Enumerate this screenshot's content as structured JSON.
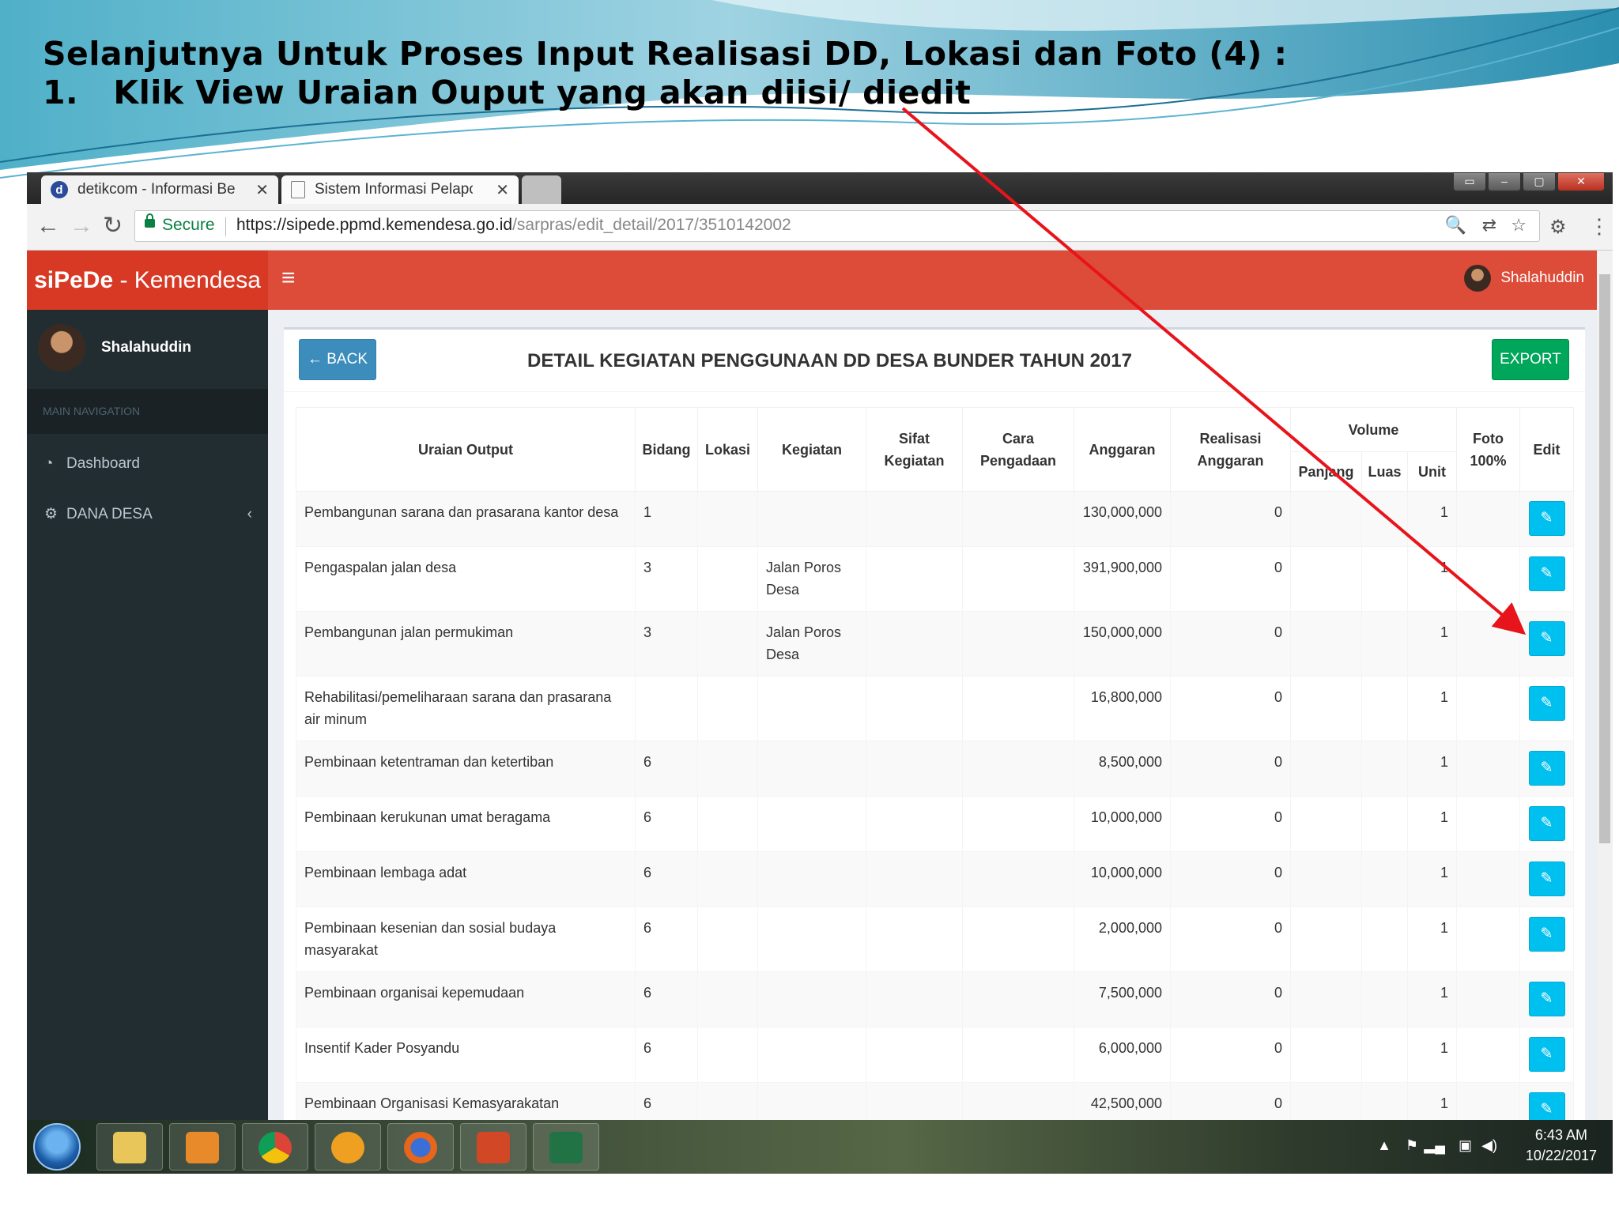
{
  "slide": {
    "title_line1": "Selanjutnya Untuk Proses Input Realisasi DD, Lokasi dan Foto (4) :",
    "title_line2": "1.   Klik View Uraian Ouput yang akan diisi/ diedit"
  },
  "browser": {
    "tabs": [
      {
        "title": "detikcom - Informasi Ber",
        "favicon": "d"
      },
      {
        "title": "Sistem Informasi Pelapor",
        "favicon": "page-icon"
      }
    ],
    "secure_label": "Secure",
    "url_host": "https://sipede.ppmd.kemendesa.go.id",
    "url_path": "/sarpras/edit_detail/2017/3510142002"
  },
  "app": {
    "logo_bold": "siPeDe",
    "logo_rest": " - Kemendesa",
    "user_name": "Shalahuddin",
    "sidebar": {
      "user_name": "Shalahuddin",
      "header": "MAIN NAVIGATION",
      "items": [
        {
          "label": "Dashboard",
          "icon": "dashboard-icon"
        },
        {
          "label": "DANA DESA",
          "icon": "cogs-icon"
        }
      ]
    },
    "back_label": "← BACK",
    "page_title": "DETAIL KEGIATAN PENGGUNAAN DD DESA BUNDER TAHUN 2017",
    "export_label": "EXPORT",
    "columns": {
      "uraian": "Uraian Output",
      "bidang": "Bidang",
      "lokasi": "Lokasi",
      "kegiatan": "Kegiatan",
      "sifat": "Sifat Kegiatan",
      "cara": "Cara Pengadaan",
      "anggaran": "Anggaran",
      "realisasi": "Realisasi Anggaran",
      "volume": "Volume",
      "panjang": "Panjang",
      "luas": "Luas",
      "unit": "Unit",
      "foto": "Foto 100%",
      "edit": "Edit"
    },
    "rows": [
      {
        "uraian": "Pembangunan sarana dan prasarana kantor desa",
        "bidang": "1",
        "kegiatan": "",
        "anggaran": "130,000,000",
        "realisasi": "0",
        "unit": "1"
      },
      {
        "uraian": "Pengaspalan jalan desa",
        "bidang": "3",
        "kegiatan": "Jalan Poros Desa",
        "anggaran": "391,900,000",
        "realisasi": "0",
        "unit": "1"
      },
      {
        "uraian": "Pembangunan jalan permukiman",
        "bidang": "3",
        "kegiatan": "Jalan Poros Desa",
        "anggaran": "150,000,000",
        "realisasi": "0",
        "unit": "1"
      },
      {
        "uraian": "Rehabilitasi/pemeliharaan sarana dan prasarana air minum",
        "bidang": "",
        "kegiatan": "",
        "anggaran": "16,800,000",
        "realisasi": "0",
        "unit": "1"
      },
      {
        "uraian": "Pembinaan ketentraman dan ketertiban",
        "bidang": "6",
        "kegiatan": "",
        "anggaran": "8,500,000",
        "realisasi": "0",
        "unit": "1"
      },
      {
        "uraian": "Pembinaan kerukunan umat beragama",
        "bidang": "6",
        "kegiatan": "",
        "anggaran": "10,000,000",
        "realisasi": "0",
        "unit": "1"
      },
      {
        "uraian": "Pembinaan lembaga adat",
        "bidang": "6",
        "kegiatan": "",
        "anggaran": "10,000,000",
        "realisasi": "0",
        "unit": "1"
      },
      {
        "uraian": "Pembinaan kesenian dan sosial budaya masyarakat",
        "bidang": "6",
        "kegiatan": "",
        "anggaran": "2,000,000",
        "realisasi": "0",
        "unit": "1"
      },
      {
        "uraian": "Pembinaan organisai kepemudaan",
        "bidang": "6",
        "kegiatan": "",
        "anggaran": "7,500,000",
        "realisasi": "0",
        "unit": "1"
      },
      {
        "uraian": "Insentif Kader Posyandu",
        "bidang": "6",
        "kegiatan": "",
        "anggaran": "6,000,000",
        "realisasi": "0",
        "unit": "1"
      },
      {
        "uraian": "Pembinaan Organisasi Kemasyarakatan",
        "bidang": "6",
        "kegiatan": "",
        "anggaran": "42,500,000",
        "realisasi": "0",
        "unit": "1"
      }
    ]
  },
  "taskbar": {
    "time": "6:43 AM",
    "date": "10/22/2017"
  },
  "colors": {
    "header_red": "#dd4b39",
    "logo_red": "#d73925",
    "sidebar_dark": "#222d32",
    "back_blue": "#3c8dbc",
    "export_green": "#00a65a",
    "edit_cyan": "#00c0ef",
    "annotation_arrow": "#e8141b"
  }
}
